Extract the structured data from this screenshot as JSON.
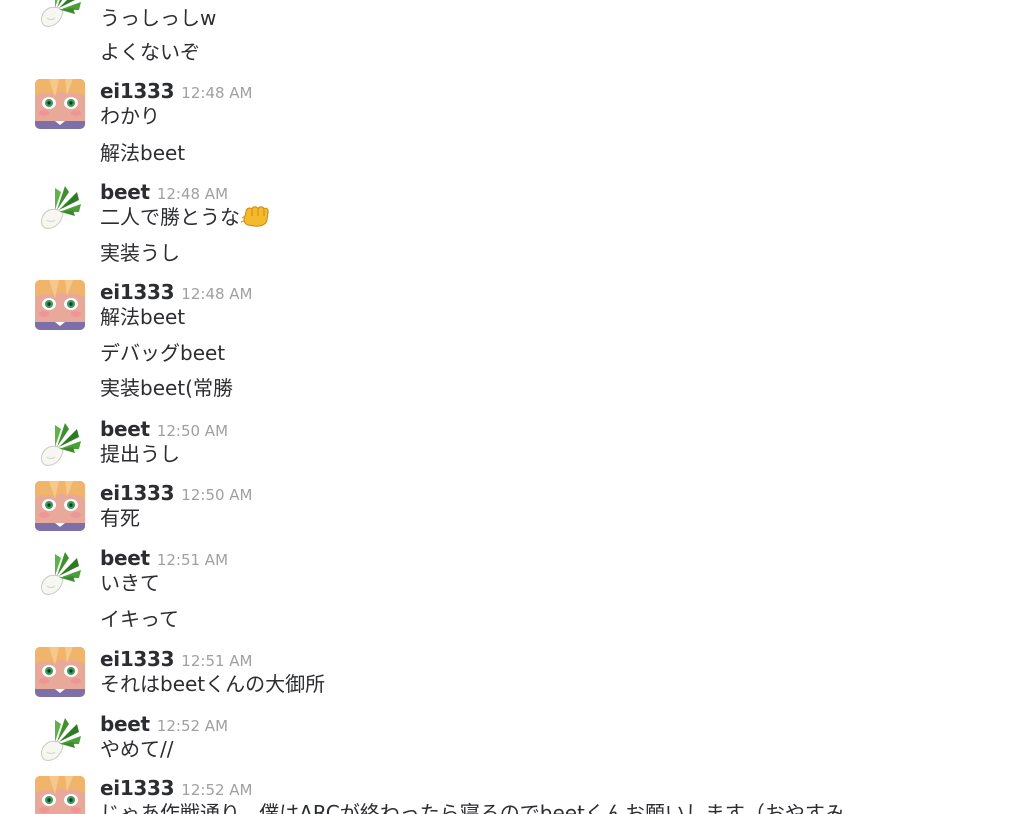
{
  "messages": {
    "m0": {
      "lines": [
        "うっしっしw",
        "よくないぞ"
      ]
    },
    "m1": {
      "author": "ei1333",
      "time": "12:48 AM",
      "lines": [
        "わかり",
        "解法beet"
      ]
    },
    "m2": {
      "author": "beet",
      "time": "12:48 AM",
      "lines": [
        "二人で勝とうな",
        "実装うし"
      ],
      "emoji": "fist-bump"
    },
    "m3": {
      "author": "ei1333",
      "time": "12:48 AM",
      "lines": [
        "解法beet",
        "デバッグbeet",
        "実装beet(常勝"
      ]
    },
    "m4": {
      "author": "beet",
      "time": "12:50 AM",
      "lines": [
        "提出うし"
      ]
    },
    "m5": {
      "author": "ei1333",
      "time": "12:50 AM",
      "lines": [
        "有死"
      ]
    },
    "m6": {
      "author": "beet",
      "time": "12:51 AM",
      "lines": [
        "いきて",
        "イキって"
      ]
    },
    "m7": {
      "author": "ei1333",
      "time": "12:51 AM",
      "lines": [
        "それはbeetくんの大御所"
      ]
    },
    "m8": {
      "author": "beet",
      "time": "12:52 AM",
      "lines": [
        "やめて//"
      ]
    },
    "m9": {
      "author": "ei1333",
      "time": "12:52 AM",
      "lines": [
        "じゃあ作戦通り、僕はARCが終わったら寝るのでbeetくんお願いします（おやすみ"
      ]
    }
  },
  "avatars": {
    "beet": "radish-avatar",
    "ei1333": "anime-girl-avatar"
  }
}
